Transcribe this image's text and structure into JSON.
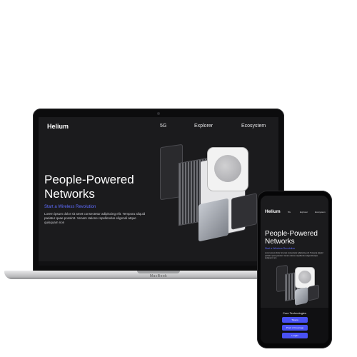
{
  "brand": "Helium",
  "nav": {
    "link_5g": "5G",
    "link_explorer": "Explorer",
    "link_ecosystem": "Ecosystem"
  },
  "hero": {
    "title": "People-Powered Networks",
    "subtitle": "Start a Wireless Revolution",
    "body": "Lorem ipsum dolor sit amet consectetur adipiscing elit. Tempora aliquid pariatur quae possimt. Venam ratione repellendus eligendi atque quisquam non"
  },
  "laptop": {
    "brand_label": "MacBook"
  },
  "phone": {
    "core_title": "Core Technologies",
    "buttons": [
      "Tokens",
      "Proof of Coverage",
      "LongFi"
    ]
  },
  "colors": {
    "accent": "#5f6cff",
    "button": "#4951f4",
    "screen_bg": "#1b1b1d"
  }
}
